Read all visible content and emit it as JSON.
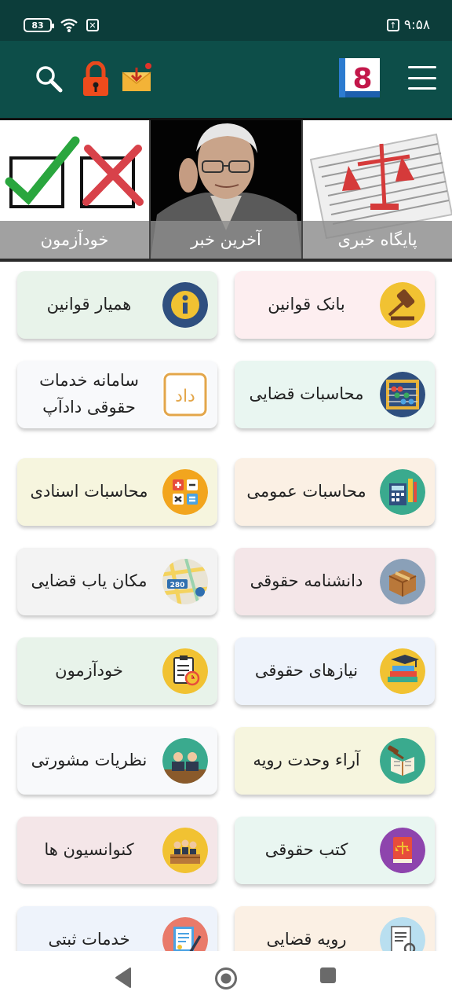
{
  "status_bar": {
    "battery": "83",
    "time": "۹:۵۸"
  },
  "app_bar": {
    "logo_text": "8"
  },
  "banners": {
    "quiz": "خودآزمون",
    "latest": "آخرین خبر",
    "news": "پایگاه خبری"
  },
  "cards": {
    "bank_laws": "بانک قوانین",
    "law_assistant": "همیار قوانین",
    "judicial_calc": "محاسبات قضایی",
    "dadapp_line1": "سامانه خدمات",
    "dadapp_line2": "حقوقی دادآپ",
    "dadapp_logo": "داد",
    "general_calc": "محاسبات عمومی",
    "document_calc": "محاسبات اسنادی",
    "legal_encyclopedia": "دانشنامه حقوقی",
    "court_locator": "مکان یاب قضایی",
    "court_locator_badge": "280",
    "legal_needs": "نیازهای حقوقی",
    "self_quiz": "خودآزمون",
    "unity_rulings": "آراء وحدت رویه",
    "advisory_opinions": "نظریات مشورتی",
    "law_books": "کتب حقوقی",
    "conventions": "کنوانسیون ها",
    "judicial_practice": "رویه قضایی",
    "registration_services": "خدمات ثبتی"
  },
  "colors": {
    "header": "#0d4e49",
    "status": "#0c3d3a",
    "card_pink": "#fdeef0",
    "card_green": "#e8f3ea",
    "card_mint": "#e9f6f1",
    "card_white": "#f8f9fb",
    "card_yellow": "#f6f5de",
    "card_peach": "#fbf0e4",
    "card_rose": "#f4e6e8",
    "card_gray": "#f3f3f3",
    "card_blue": "#eef3fb"
  }
}
